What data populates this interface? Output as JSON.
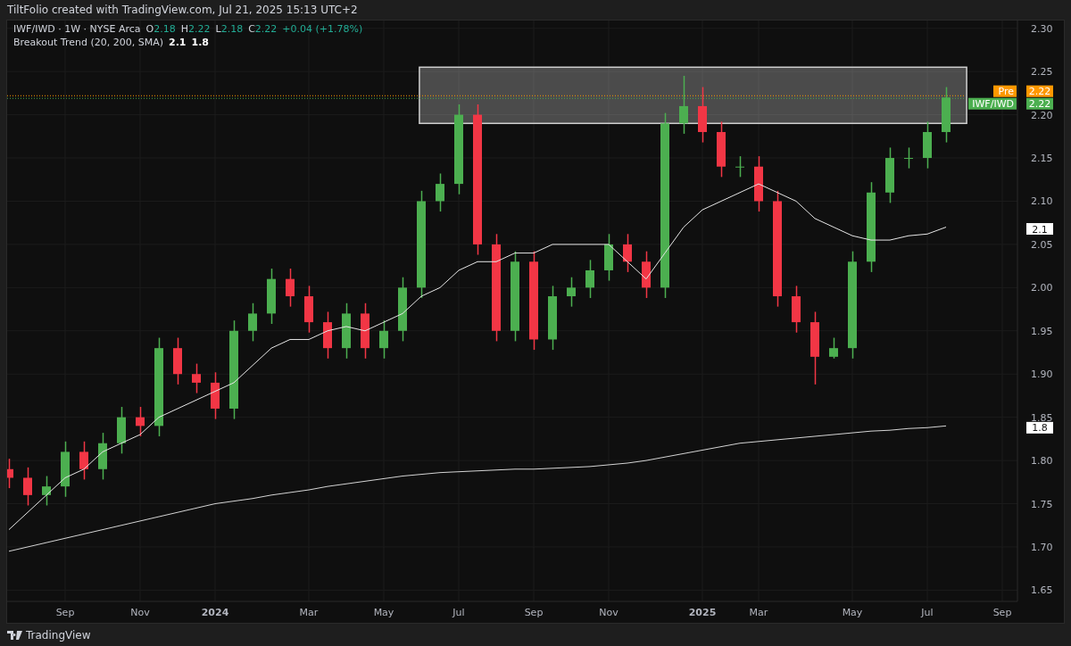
{
  "header": {
    "title": "TiltFolio created with TradingView.com, Jul 21, 2025 15:13 UTC+2"
  },
  "legend": {
    "symbol": "IWF/IWD · 1W · NYSE Arca",
    "ohlc": [
      {
        "letter": "O",
        "value": "2.18"
      },
      {
        "letter": "H",
        "value": "2.22"
      },
      {
        "letter": "L",
        "value": "2.18"
      },
      {
        "letter": "C",
        "value": "2.22"
      }
    ],
    "change": "+0.04 (+1.78%)",
    "indicator": "Breakout Trend (20, 200, SMA)",
    "indicator_values": [
      "2.1",
      "1.8"
    ]
  },
  "chart": {
    "chart_data": {
      "type": "candlestick",
      "categories": [
        null,
        null,
        null,
        "Sep",
        null,
        null,
        null,
        "Nov",
        null,
        null,
        null,
        "2024",
        null,
        null,
        null,
        null,
        "Mar",
        null,
        null,
        null,
        "May",
        null,
        null,
        null,
        "Jul",
        null,
        null,
        null,
        "Sep",
        null,
        null,
        null,
        "Nov",
        null,
        null,
        null,
        null,
        "2025",
        null,
        null,
        "Mar",
        null,
        null,
        null,
        null,
        "May",
        null,
        null,
        null,
        "Jul",
        null,
        null,
        null,
        "Sep"
      ],
      "ohlc": [
        [
          1.79,
          1.802,
          1.768,
          1.78
        ],
        [
          1.78,
          1.792,
          1.748,
          1.76
        ],
        [
          1.76,
          1.782,
          1.748,
          1.77
        ],
        [
          1.77,
          1.822,
          1.758,
          1.81
        ],
        [
          1.81,
          1.822,
          1.778,
          1.79
        ],
        [
          1.79,
          1.832,
          1.778,
          1.82
        ],
        [
          1.82,
          1.862,
          1.808,
          1.85
        ],
        [
          1.85,
          1.862,
          1.828,
          1.84
        ],
        [
          1.84,
          1.942,
          1.828,
          1.93
        ],
        [
          1.93,
          1.942,
          1.888,
          1.9
        ],
        [
          1.9,
          1.912,
          1.878,
          1.89
        ],
        [
          1.89,
          1.902,
          1.848,
          1.86
        ],
        [
          1.86,
          1.962,
          1.848,
          1.95
        ],
        [
          1.95,
          1.982,
          1.938,
          1.97
        ],
        [
          1.97,
          2.022,
          1.958,
          2.01
        ],
        [
          2.01,
          2.022,
          1.978,
          1.99
        ],
        [
          1.99,
          2.002,
          1.948,
          1.96
        ],
        [
          1.96,
          1.972,
          1.918,
          1.93
        ],
        [
          1.93,
          1.982,
          1.918,
          1.97
        ],
        [
          1.97,
          1.982,
          1.918,
          1.93
        ],
        [
          1.93,
          1.962,
          1.918,
          1.95
        ],
        [
          1.95,
          2.012,
          1.938,
          2.0
        ],
        [
          2.0,
          2.112,
          1.988,
          2.1
        ],
        [
          2.1,
          2.132,
          2.088,
          2.12
        ],
        [
          2.12,
          2.212,
          2.108,
          2.2
        ],
        [
          2.2,
          2.212,
          2.038,
          2.05
        ],
        [
          2.05,
          2.062,
          1.938,
          1.95
        ],
        [
          1.95,
          2.042,
          1.938,
          2.03
        ],
        [
          2.03,
          2.042,
          1.928,
          1.94
        ],
        [
          1.94,
          2.002,
          1.928,
          1.99
        ],
        [
          1.99,
          2.012,
          1.978,
          2.0
        ],
        [
          2.0,
          2.032,
          1.988,
          2.02
        ],
        [
          2.02,
          2.062,
          2.008,
          2.05
        ],
        [
          2.05,
          2.062,
          2.018,
          2.03
        ],
        [
          2.03,
          2.042,
          1.988,
          2.0
        ],
        [
          2.0,
          2.202,
          1.988,
          2.19
        ],
        [
          2.19,
          2.245,
          2.178,
          2.21
        ],
        [
          2.21,
          2.232,
          2.168,
          2.18
        ],
        [
          2.18,
          2.192,
          2.128,
          2.14
        ],
        [
          2.14,
          2.152,
          2.128,
          2.14
        ],
        [
          2.14,
          2.152,
          2.088,
          2.1
        ],
        [
          2.1,
          2.112,
          1.978,
          1.99
        ],
        [
          1.99,
          2.002,
          1.948,
          1.96
        ],
        [
          1.96,
          1.972,
          1.888,
          1.92
        ],
        [
          1.92,
          1.942,
          1.918,
          1.93
        ],
        [
          1.93,
          2.042,
          1.918,
          2.03
        ],
        [
          2.03,
          2.122,
          2.018,
          2.11
        ],
        [
          2.11,
          2.162,
          2.098,
          2.15
        ],
        [
          2.15,
          2.162,
          2.138,
          2.15
        ],
        [
          2.15,
          2.192,
          2.138,
          2.18
        ],
        [
          2.18,
          2.232,
          2.168,
          2.22
        ],
        null,
        null,
        null
      ],
      "series": [
        {
          "type": "line",
          "color": "#e6e6e6",
          "values": [
            1.72,
            1.74,
            1.76,
            1.78,
            1.79,
            1.81,
            1.82,
            1.83,
            1.85,
            1.86,
            1.87,
            1.88,
            1.89,
            1.91,
            1.93,
            1.94,
            1.94,
            1.95,
            1.955,
            1.95,
            1.96,
            1.97,
            1.99,
            2.0,
            2.02,
            2.03,
            2.03,
            2.04,
            2.04,
            2.05,
            2.05,
            2.05,
            2.05,
            2.03,
            2.01,
            2.04,
            2.07,
            2.09,
            2.1,
            2.11,
            2.12,
            2.11,
            2.1,
            2.08,
            2.07,
            2.06,
            2.055,
            2.055,
            2.06,
            2.062,
            2.07,
            null,
            null,
            null
          ]
        },
        {
          "type": "line",
          "color": "#d4d4d4",
          "values": [
            1.695,
            1.7,
            1.705,
            1.71,
            1.715,
            1.72,
            1.725,
            1.73,
            1.735,
            1.74,
            1.745,
            1.75,
            1.753,
            1.756,
            1.76,
            1.763,
            1.766,
            1.77,
            1.773,
            1.776,
            1.779,
            1.782,
            1.784,
            1.786,
            1.787,
            1.788,
            1.789,
            1.79,
            1.79,
            1.791,
            1.792,
            1.793,
            1.795,
            1.797,
            1.8,
            1.804,
            1.808,
            1.812,
            1.816,
            1.82,
            1.822,
            1.824,
            1.826,
            1.828,
            1.83,
            1.832,
            1.834,
            1.835,
            1.837,
            1.838,
            1.84,
            null,
            null,
            null
          ]
        }
      ],
      "ylim": [
        1.637,
        2.309
      ],
      "grid": true,
      "ref_lines": [
        {
          "axis": "y",
          "value": 2.222,
          "color": "#ff9800"
        },
        {
          "axis": "y",
          "value": 2.219,
          "color": "#4caf50"
        }
      ],
      "yticks": [
        {
          "value": 1.65,
          "label": "1.65"
        },
        {
          "value": 1.7,
          "label": "1.70"
        },
        {
          "value": 1.75,
          "label": "1.75"
        },
        {
          "value": 1.8,
          "label": "1.80"
        },
        {
          "value": 1.85,
          "label": "1.85"
        },
        {
          "value": 1.9,
          "label": "1.90"
        },
        {
          "value": 1.95,
          "label": "1.95"
        },
        {
          "value": 2.0,
          "label": "2.00"
        },
        {
          "value": 2.05,
          "label": "2.05"
        },
        {
          "value": 2.1,
          "label": "2.10"
        },
        {
          "value": 2.15,
          "label": "2.15"
        },
        {
          "value": 2.2,
          "label": "2.20"
        },
        {
          "value": 2.25,
          "label": "2.25"
        },
        {
          "value": 2.3,
          "label": "2.30"
        }
      ]
    },
    "price_labels": [
      {
        "kind": "premarket",
        "tag": "Pre",
        "text": "2.22",
        "color": "#ff9800"
      },
      {
        "kind": "last",
        "tag": "IWF/IWD",
        "text": "2.22",
        "color": "#4caf50"
      },
      {
        "kind": "indicator",
        "text": "2.1",
        "color": "#ffffff"
      },
      {
        "kind": "indicator",
        "text": "1.8",
        "color": "#ffffff"
      }
    ]
  },
  "footer": {
    "brand": "TradingView"
  }
}
